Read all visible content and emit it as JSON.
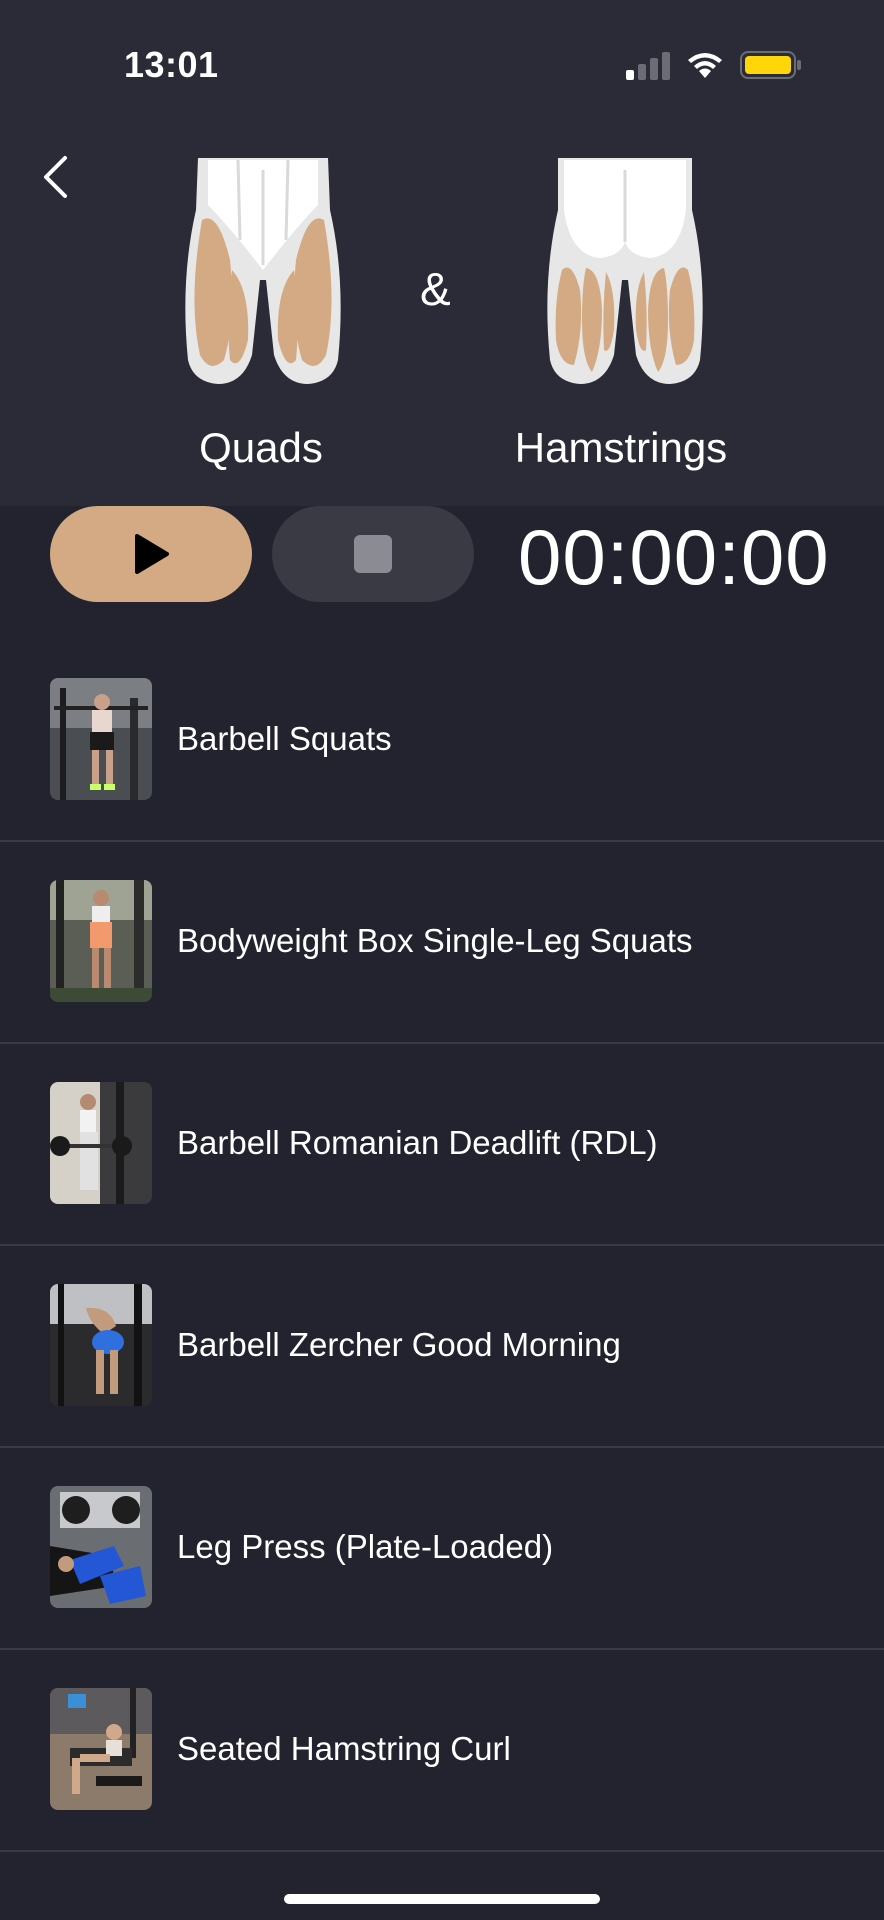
{
  "status_bar": {
    "time": "13:01"
  },
  "header": {
    "muscles": [
      {
        "name": "Quads",
        "icon": "quads-diagram"
      },
      {
        "name": "Hamstrings",
        "icon": "hamstrings-diagram"
      }
    ],
    "separator": "&",
    "accent_color": "#d3aa83"
  },
  "controls": {
    "timer": "00:00:00"
  },
  "exercises": [
    {
      "name": "Barbell Squats"
    },
    {
      "name": "Bodyweight Box Single-Leg Squats"
    },
    {
      "name": "Barbell Romanian Deadlift (RDL)"
    },
    {
      "name": "Barbell Zercher Good Morning"
    },
    {
      "name": "Leg Press (Plate-Loaded)"
    },
    {
      "name": "Seated Hamstring Curl"
    }
  ]
}
